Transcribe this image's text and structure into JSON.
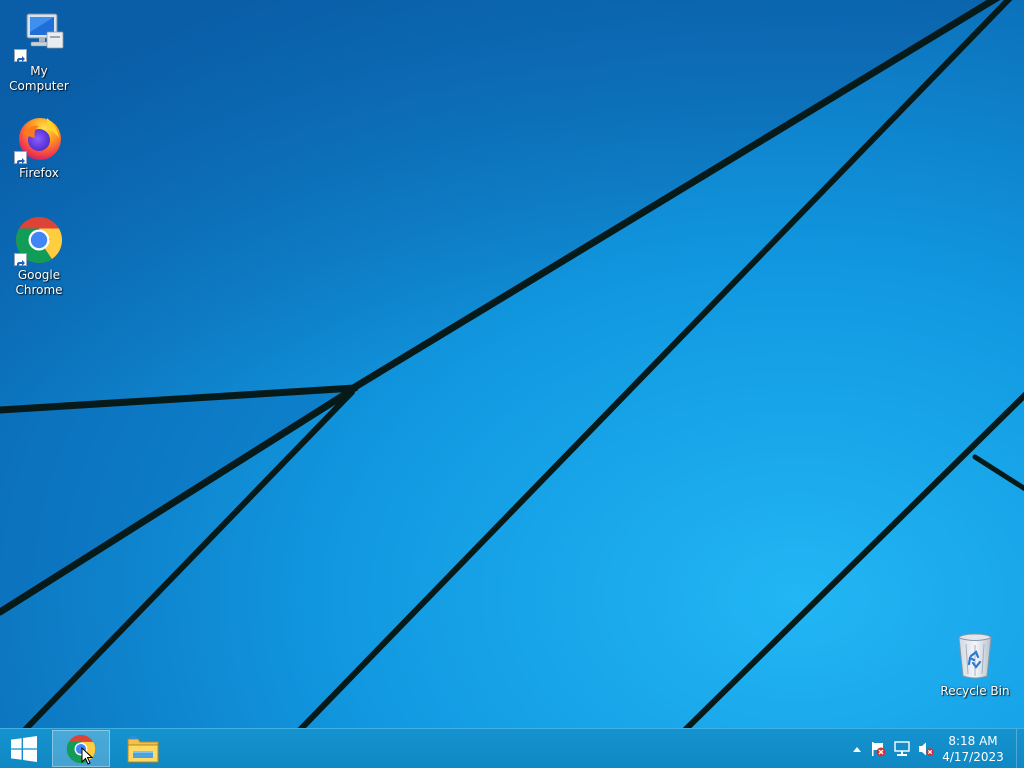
{
  "desktop": {
    "icons": [
      {
        "label": "My Computer",
        "icon": "my-computer-icon"
      },
      {
        "label": "Firefox",
        "icon": "firefox-icon"
      },
      {
        "label": "Google Chrome",
        "icon": "chrome-icon"
      },
      {
        "label": "Recycle Bin",
        "icon": "recycle-bin-icon"
      }
    ],
    "wallpaper_colors": {
      "dark": "#0a5fa8",
      "mid": "#0f86d8",
      "light": "#17a6ec",
      "line": "#061a1a"
    }
  },
  "taskbar": {
    "color": "#1190cc",
    "start_icon": "windows-logo-icon",
    "pinned": [
      {
        "icon": "chrome-icon",
        "active": true
      },
      {
        "icon": "file-explorer-icon",
        "active": false
      }
    ],
    "tray": {
      "icons": [
        "show-hidden-icons-chevron",
        "action-center-flag-icon",
        "network-icon",
        "volume-muted-icon"
      ]
    },
    "clock": {
      "time": "8:18 AM",
      "date": "4/17/2023"
    }
  }
}
